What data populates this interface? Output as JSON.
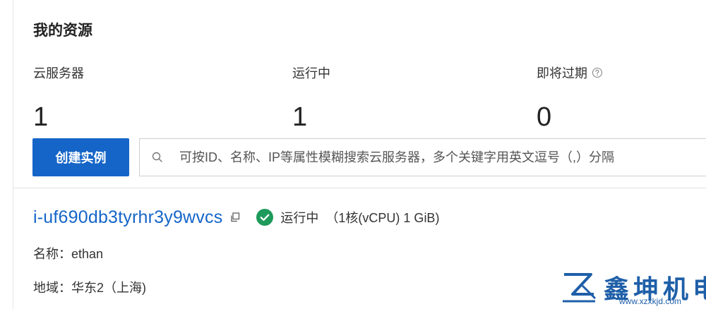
{
  "section_title": "我的资源",
  "stats": [
    {
      "label": "云服务器",
      "value": "1"
    },
    {
      "label": "运行中",
      "value": "1"
    },
    {
      "label": "即将过期",
      "value": "0",
      "help_icon": "question-circle-icon"
    }
  ],
  "toolbar": {
    "create_label": "创建实例",
    "search_placeholder": "可按ID、名称、IP等属性模糊搜索云服务器，多个关键字用英文逗号（,）分隔",
    "search_value": ""
  },
  "instance": {
    "id": "i-uf690db3tyrhr3y9wvcs",
    "status": "运行中",
    "spec": "（1核(vCPU) 1 GiB)",
    "name_line": "名称：ethan",
    "region_line": "地域：华东2（上海)"
  },
  "watermark": {
    "text": "鑫坤机电",
    "url": "www.xzxkjd.com"
  },
  "colors": {
    "accent": "#1565c8",
    "status_ok": "#1e9a5a",
    "watermark": "#1f5fa8"
  },
  "icons": [
    "search-icon",
    "copy-icon",
    "check-circle-icon",
    "question-circle-icon"
  ]
}
